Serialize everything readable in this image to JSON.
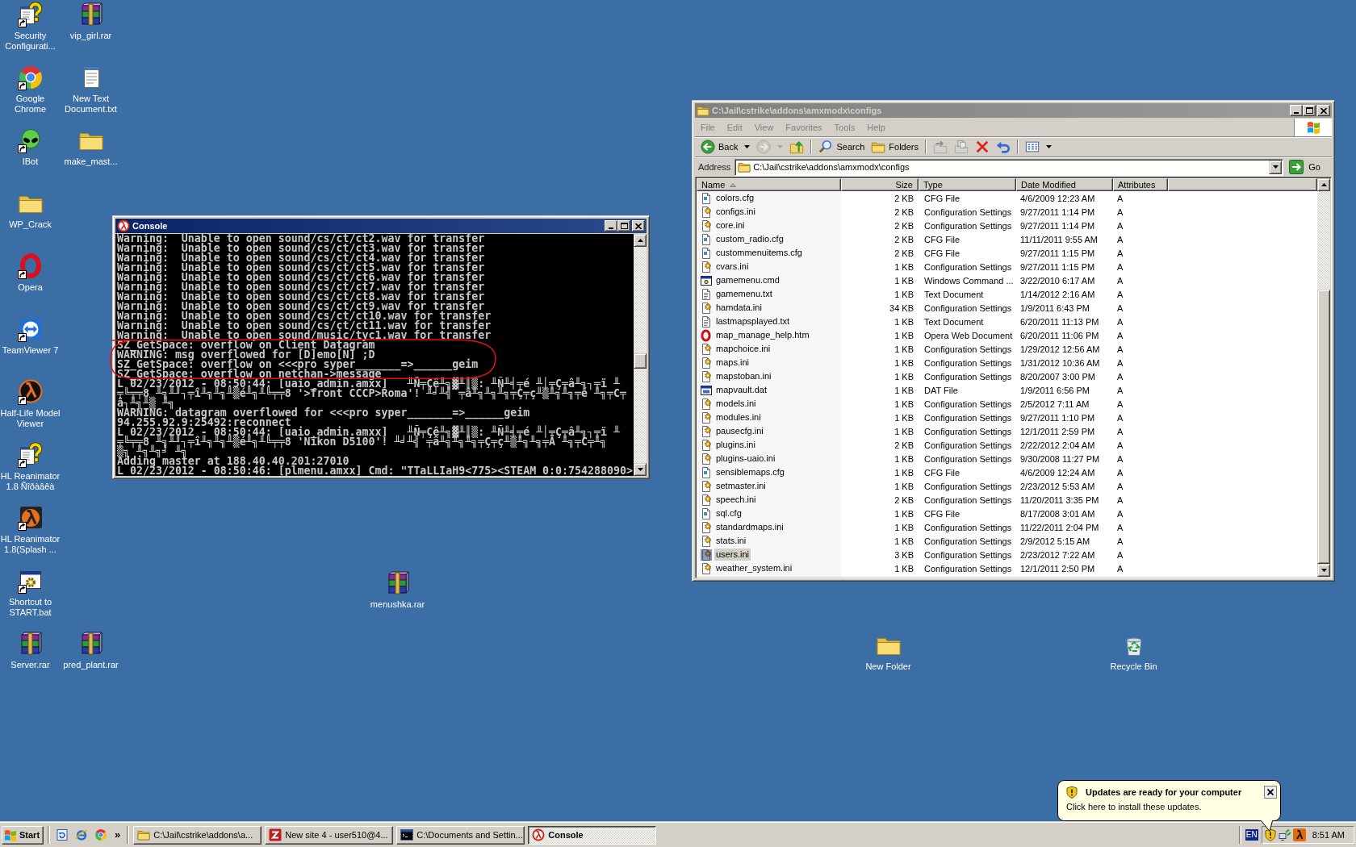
{
  "desktop": {
    "icons": [
      {
        "label": "Security\nConfigurati...",
        "kind": "question-doc",
        "shortcut": true
      },
      {
        "label": "vip_girl.rar",
        "kind": "archive",
        "shortcut": false
      },
      {
        "label": "Google\nChrome",
        "kind": "browser",
        "shortcut": true
      },
      {
        "label": "New Text\nDocument.txt",
        "kind": "notepad",
        "shortcut": false
      },
      {
        "label": "IBot",
        "kind": "alien",
        "shortcut": true
      },
      {
        "label": "make_mast...",
        "kind": "folder",
        "shortcut": false
      },
      {
        "label": "WP_Crack",
        "kind": "folder",
        "shortcut": false
      },
      {
        "label": "Opera",
        "kind": "opera",
        "shortcut": true
      },
      {
        "label": "TeamViewer 7",
        "kind": "remote",
        "shortcut": true
      },
      {
        "label": "Half-Life Model\nViewer",
        "kind": "lambda-mv",
        "shortcut": true
      },
      {
        "label": "HL Reanimator\n1.8 Ñîðàâêà",
        "kind": "question-doc",
        "shortcut": true
      },
      {
        "label": "HL Reanimator\n1.8(Splash ...",
        "kind": "lambda-r",
        "shortcut": true
      },
      {
        "label": "Shortcut to\nSTART.bat",
        "kind": "batch",
        "shortcut": true
      },
      {
        "label": "menushka.rar",
        "kind": "archive",
        "shortcut": false
      },
      {
        "label": "Server.rar",
        "kind": "archive",
        "shortcut": false
      },
      {
        "label": "pred_plant.rar",
        "kind": "archive",
        "shortcut": false
      },
      {
        "label": "New Folder",
        "kind": "folder",
        "shortcut": false
      },
      {
        "label": "Recycle Bin",
        "kind": "recycle",
        "shortcut": false
      }
    ]
  },
  "console_window": {
    "title": "Console",
    "active": true,
    "hand_drawn_loop": true,
    "lines": [
      "Warning:  Unable to open sound/cs/ct/ct2.wav for transfer",
      "Warning:  Unable to open sound/cs/ct/ct3.wav for transfer",
      "Warning:  Unable to open sound/cs/ct/ct4.wav for transfer",
      "Warning:  Unable to open sound/cs/ct/ct5.wav for transfer",
      "Warning:  Unable to open sound/cs/ct/ct6.wav for transfer",
      "Warning:  Unable to open sound/cs/ct/ct7.wav for transfer",
      "Warning:  Unable to open sound/cs/ct/ct8.wav for transfer",
      "Warning:  Unable to open sound/cs/ct/ct9.wav for transfer",
      "Warning:  Unable to open sound/cs/ct/ct10.wav for transfer",
      "Warning:  Unable to open sound/cs/ct/ct11.wav for transfer",
      "Warning:  Unable to open sound/music/tyc1.wav for transfer",
      "SZ_GetSpace: overflow on Client Datagram",
      "WARNING: msg overflowed for [D]emo[N] ;D",
      "SZ_GetSpace: overflow on <<<pro syper_______=>______geim",
      "SZ_GetSpace: overflow on netchan->message",
      "L 02/23/2012 - 08:50:44: [uaio_admin.amxx]   ╨Ñ╤Çê╨╗▓╨║▒: ╨Ñ╨╡╤é ╨│╤Ç╤â╨╗┐╤ï ╨",
      "╤╚╤╤8 ╨╗╨╜┐╤î╨╗╨╗╨▒é╨╗╨╚╤╤8 '>front CCCP>Roma'! ╨╛╨╣ ╤â╨╗╨╗╨╗╤Ç╤ç╨▒╨╗╨╗╤é ╨╗╤C╤",
      "â┐╨╗╨▒ ╨╗",
      "WARNING: datagram overflowed for <<<pro syper_______=>______geim",
      "94.255.92.9:25492:reconnect",
      "L 02/23/2012 - 08:50:44: [uaio_admin.amxx]   ╨Ñ╤Çê╨╗▓╨║▒: ╨Ñ╨╡╤é ╨│╤Ç╤â╨╗┐╤ï ╨",
      "╤╚╤╤8 ╨╗╨╜┐╤î╨╗╨╗╨▒é╨╗╨╚╤╤8 'Nikon D5100'! ╨╛╨╣ ╤â╨╗╨╗╨╗╤Ç╤ç╨▒╨╗╨╗╤Ä ╨╗╤C╤╨╗",
      "▒╗ ╨╗╨╗╛ ╨╗",
      "Adding master at 188.40.40.201:27010",
      "L 02/23/2012 - 08:50:46: [plmenu.amxx] Cmd: \"TTaLLIaH9<775><STEAM_0:0:754288090>"
    ]
  },
  "explorer_window": {
    "title": "C:\\Jail\\cstrike\\addons\\amxmodx\\configs",
    "active": false,
    "menu": [
      "File",
      "Edit",
      "View",
      "Favorites",
      "Tools",
      "Help"
    ],
    "toolbar": [
      {
        "kind": "back",
        "label": "Back",
        "disabled": false
      },
      {
        "kind": "forward",
        "disabled": true
      },
      {
        "kind": "up",
        "disabled": false
      },
      {
        "kind": "search",
        "label": "Search",
        "disabled": false
      },
      {
        "kind": "folders",
        "label": "Folders",
        "disabled": false
      },
      {
        "kind": "move",
        "disabled": true
      },
      {
        "kind": "copy",
        "disabled": true
      },
      {
        "kind": "delete",
        "disabled": false
      },
      {
        "kind": "undo",
        "disabled": false
      },
      {
        "kind": "views",
        "disabled": false
      }
    ],
    "address": {
      "label": "Address",
      "value": "C:\\Jail\\cstrike\\addons\\amxmodx\\configs",
      "go": "Go"
    },
    "columns": [
      {
        "label": "Name",
        "sorted": true
      },
      {
        "label": "Size",
        "sorted": false
      },
      {
        "label": "Type",
        "sorted": false
      },
      {
        "label": "Date Modified",
        "sorted": false
      },
      {
        "label": "Attributes",
        "sorted": false
      }
    ],
    "rows": [
      {
        "name": "colors.cfg",
        "kind": "cfg",
        "size": "2 KB",
        "type": "CFG File",
        "modified": "4/6/2009 12:23 AM",
        "attributes": "A",
        "selected": false
      },
      {
        "name": "configs.ini",
        "kind": "ini",
        "size": "2 KB",
        "type": "Configuration Settings",
        "modified": "9/27/2011 1:14 PM",
        "attributes": "A",
        "selected": false
      },
      {
        "name": "core.ini",
        "kind": "ini",
        "size": "2 KB",
        "type": "Configuration Settings",
        "modified": "9/27/2011 1:14 PM",
        "attributes": "A",
        "selected": false
      },
      {
        "name": "custom_radio.cfg",
        "kind": "cfg",
        "size": "2 KB",
        "type": "CFG File",
        "modified": "11/11/2011 9:55 AM",
        "attributes": "A",
        "selected": false
      },
      {
        "name": "custommenuitems.cfg",
        "kind": "cfg",
        "size": "2 KB",
        "type": "CFG File",
        "modified": "9/27/2011 1:15 PM",
        "attributes": "A",
        "selected": false
      },
      {
        "name": "cvars.ini",
        "kind": "ini",
        "size": "1 KB",
        "type": "Configuration Settings",
        "modified": "9/27/2011 1:15 PM",
        "attributes": "A",
        "selected": false
      },
      {
        "name": "gamemenu.cmd",
        "kind": "cmd",
        "size": "1 KB",
        "type": "Windows Command ...",
        "modified": "3/22/2010 6:17 AM",
        "attributes": "A",
        "selected": false
      },
      {
        "name": "gamemenu.txt",
        "kind": "txt",
        "size": "1 KB",
        "type": "Text Document",
        "modified": "1/14/2012 2:16 AM",
        "attributes": "A",
        "selected": false
      },
      {
        "name": "hamdata.ini",
        "kind": "ini",
        "size": "34 KB",
        "type": "Configuration Settings",
        "modified": "1/9/2011 6:43 PM",
        "attributes": "A",
        "selected": false
      },
      {
        "name": "lastmapsplayed.txt",
        "kind": "txt",
        "size": "1 KB",
        "type": "Text Document",
        "modified": "6/20/2011 11:13 PM",
        "attributes": "A",
        "selected": false
      },
      {
        "name": "map_manage_help.htm",
        "kind": "htm",
        "size": "1 KB",
        "type": "Opera Web Document",
        "modified": "6/20/2011 11:06 PM",
        "attributes": "A",
        "selected": false
      },
      {
        "name": "mapchoice.ini",
        "kind": "ini",
        "size": "1 KB",
        "type": "Configuration Settings",
        "modified": "1/29/2012 12:56 AM",
        "attributes": "A",
        "selected": false
      },
      {
        "name": "maps.ini",
        "kind": "ini",
        "size": "1 KB",
        "type": "Configuration Settings",
        "modified": "1/31/2012 10:36 AM",
        "attributes": "A",
        "selected": false
      },
      {
        "name": "mapstoban.ini",
        "kind": "ini",
        "size": "1 KB",
        "type": "Configuration Settings",
        "modified": "8/20/2007 3:00 PM",
        "attributes": "A",
        "selected": false
      },
      {
        "name": "mapvault.dat",
        "kind": "dat",
        "size": "1 KB",
        "type": "DAT File",
        "modified": "1/9/2011 6:56 PM",
        "attributes": "A",
        "selected": false
      },
      {
        "name": "models.ini",
        "kind": "ini",
        "size": "1 KB",
        "type": "Configuration Settings",
        "modified": "2/5/2012 7:11 AM",
        "attributes": "A",
        "selected": false
      },
      {
        "name": "modules.ini",
        "kind": "ini",
        "size": "1 KB",
        "type": "Configuration Settings",
        "modified": "9/27/2011 1:10 PM",
        "attributes": "A",
        "selected": false
      },
      {
        "name": "pausecfg.ini",
        "kind": "ini",
        "size": "1 KB",
        "type": "Configuration Settings",
        "modified": "12/1/2011 2:59 PM",
        "attributes": "A",
        "selected": false
      },
      {
        "name": "plugins.ini",
        "kind": "ini",
        "size": "2 KB",
        "type": "Configuration Settings",
        "modified": "2/22/2012 2:04 AM",
        "attributes": "A",
        "selected": false
      },
      {
        "name": "plugins-uaio.ini",
        "kind": "ini",
        "size": "1 KB",
        "type": "Configuration Settings",
        "modified": "9/30/2008 11:27 PM",
        "attributes": "A",
        "selected": false
      },
      {
        "name": "sensiblemaps.cfg",
        "kind": "cfg",
        "size": "1 KB",
        "type": "CFG File",
        "modified": "4/6/2009 12:24 AM",
        "attributes": "A",
        "selected": false
      },
      {
        "name": "setmaster.ini",
        "kind": "ini",
        "size": "1 KB",
        "type": "Configuration Settings",
        "modified": "2/23/2012 5:53 AM",
        "attributes": "A",
        "selected": false
      },
      {
        "name": "speech.ini",
        "kind": "ini",
        "size": "2 KB",
        "type": "Configuration Settings",
        "modified": "11/20/2011 3:35 PM",
        "attributes": "A",
        "selected": false
      },
      {
        "name": "sql.cfg",
        "kind": "cfg",
        "size": "1 KB",
        "type": "CFG File",
        "modified": "8/17/2008 3:01 AM",
        "attributes": "A",
        "selected": false
      },
      {
        "name": "standardmaps.ini",
        "kind": "ini",
        "size": "1 KB",
        "type": "Configuration Settings",
        "modified": "11/22/2011 2:04 PM",
        "attributes": "A",
        "selected": false
      },
      {
        "name": "stats.ini",
        "kind": "ini",
        "size": "1 KB",
        "type": "Configuration Settings",
        "modified": "2/9/2012 5:15 AM",
        "attributes": "A",
        "selected": false
      },
      {
        "name": "users.ini",
        "kind": "ini",
        "size": "3 KB",
        "type": "Configuration Settings",
        "modified": "2/23/2012 7:22 AM",
        "attributes": "A",
        "selected": true
      },
      {
        "name": "weather_system.ini",
        "kind": "ini",
        "size": "1 KB",
        "type": "Configuration Settings",
        "modified": "12/1/2011 2:50 PM",
        "attributes": "A",
        "selected": false
      }
    ]
  },
  "notification": {
    "title": "Updates are ready for your computer",
    "message": "Click here to install these updates."
  },
  "taskbar": {
    "start_label": "Start",
    "quick_launch": [
      {
        "kind": "refresh-page"
      },
      {
        "kind": "globe-e"
      },
      {
        "kind": "browser"
      }
    ],
    "chevron": "»",
    "tasks": [
      {
        "label": "C:\\Jail\\cstrike\\addons\\a...",
        "kind": "folder",
        "selected": false
      },
      {
        "label": "New site 4 - user510@4...",
        "kind": "ftp",
        "selected": false
      },
      {
        "label": "C:\\Documents and Settin...",
        "kind": "cmd",
        "selected": false
      },
      {
        "label": "Console",
        "kind": "lambda",
        "selected": true
      }
    ],
    "language": "EN",
    "tray_icons": [
      {
        "kind": "shield"
      },
      {
        "kind": "network"
      },
      {
        "kind": "lambda"
      }
    ],
    "clock": "8:51 AM"
  }
}
